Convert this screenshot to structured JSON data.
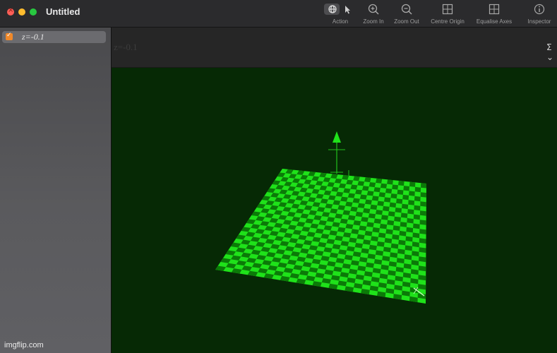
{
  "window": {
    "title": "Untitled"
  },
  "toolbar": {
    "action_label": "Action",
    "zoom_in_label": "Zoom In",
    "zoom_out_label": "Zoom Out",
    "centre_origin_label": "Centre Origin",
    "equalise_axes_label": "Equalise Axes",
    "inspector_label": "Inspector"
  },
  "sidebar": {
    "items": [
      {
        "label": "z=-0.1",
        "checked": true
      }
    ]
  },
  "equation_bar": {
    "text": "z=-0.1",
    "sigma": "Σ"
  },
  "watermark": "imgflip.com",
  "colors": {
    "surface_light": "#1fe21a",
    "surface_dark": "#0b7a08",
    "background": "#062905",
    "accent": "#f0892a"
  }
}
